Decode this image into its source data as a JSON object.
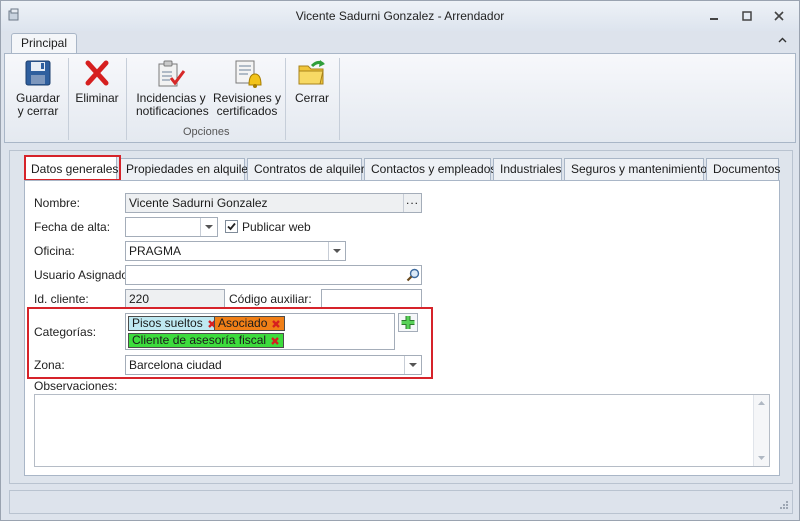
{
  "window": {
    "title": "Vicente Sadurni Gonzalez - Arrendador"
  },
  "ribbon": {
    "tab": "Principal",
    "buttons": {
      "save": "Guardar\ny cerrar",
      "delete": "Eliminar",
      "incidents": "Incidencias y\nnotificaciones",
      "reviews": "Revisiones y\ncertificados",
      "close": "Cerrar"
    },
    "group_label": "Opciones"
  },
  "tabs": [
    {
      "label": "Datos generales"
    },
    {
      "label": "Propiedades en alquiler"
    },
    {
      "label": "Contratos de alquiler"
    },
    {
      "label": "Contactos y empleados"
    },
    {
      "label": "Industriales"
    },
    {
      "label": "Seguros y mantenimientos"
    },
    {
      "label": "Documentos"
    }
  ],
  "form": {
    "nombre": {
      "label": "Nombre:",
      "value": "Vicente Sadurni Gonzalez"
    },
    "fecha_alta": {
      "label": "Fecha de alta:",
      "value": ""
    },
    "publicar_web": {
      "label": "Publicar web",
      "checked": true
    },
    "oficina": {
      "label": "Oficina:",
      "value": "PRAGMA"
    },
    "usuario": {
      "label": "Usuario Asignado:",
      "value": ""
    },
    "id_cliente": {
      "label": "Id. cliente:",
      "value": "220"
    },
    "codigo_auxiliar": {
      "label": "Código auxiliar:",
      "value": ""
    },
    "categorias": {
      "label": "Categorías:",
      "tags": [
        {
          "text": "Pisos sueltos",
          "color": "#bfe9f2"
        },
        {
          "text": "Asociado",
          "color": "#f07f17"
        },
        {
          "text": "Cliente de asesoría fiscal",
          "color": "#3ddc3d"
        }
      ]
    },
    "zona": {
      "label": "Zona:",
      "value": "Barcelona ciudad"
    },
    "observaciones": {
      "label": "Observaciones:",
      "value": ""
    }
  },
  "colors": {
    "highlight": "#d6232a",
    "ribbon_bg": "#eef1f6"
  }
}
